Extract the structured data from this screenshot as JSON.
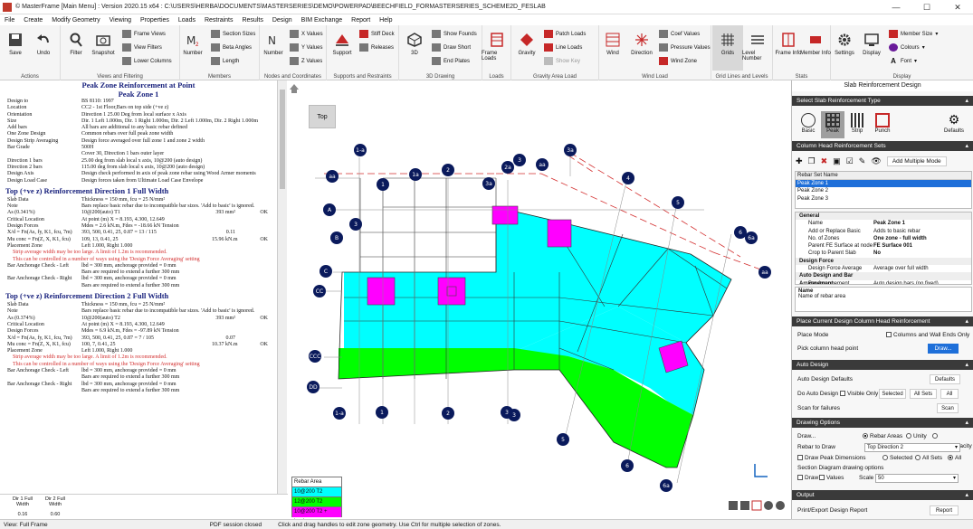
{
  "window": {
    "title": "© MasterFrame [Main Menu] : Version 2020.15 x64 : C:\\USERS\\HERBA\\DOCUMENTS\\MASTERSERIES\\DEMO\\POWERPAD\\BEECHFIELD_FORMASTERSERIES_SCHEME2D_FESLAB",
    "min": "—",
    "max": "☐",
    "close": "✕"
  },
  "menu": [
    "File",
    "Create",
    "Modify Geometry",
    "Viewing",
    "Properties",
    "Loads",
    "Restraints",
    "Results",
    "Design",
    "BIM Exchange",
    "Report",
    "Help"
  ],
  "ribbon": {
    "save": "Save",
    "undo": "Undo",
    "filter": "Filter",
    "snapshot": "Snapshot",
    "frame_views": "Frame Views",
    "view_filters": "View Filters",
    "lower_columns": "Lower Columns",
    "number": "Number",
    "section_sizes": "Section Sizes",
    "beta_angles": "Beta Angles",
    "length": "Length",
    "number2": "Number",
    "x_values": "X Values",
    "y_values": "Y Values",
    "z_values": "Z Values",
    "support": "Support",
    "stiff_deck": "Stiff Deck",
    "releases": "Releases",
    "three_d": "3D",
    "show_founds": "Show Founds",
    "draw_short": "Draw Short",
    "end_plates": "End Plates",
    "frame_loads": "Frame Loads",
    "gravity": "Gravity",
    "patch_loads": "Patch Loads",
    "line_loads": "Line Loads",
    "show_key": "Show Key",
    "wind": "Wind",
    "direction": "Direction",
    "coef_values": "Coef Values",
    "pressure_values": "Pressure Values",
    "wind_zone": "Wind Zone",
    "grids": "Grids",
    "level_number": "Level Number",
    "frame_info": "Frame Info",
    "member_info": "Member Info",
    "settings": "Settings",
    "display": "Display",
    "member_size": "Member Size",
    "colours": "Colours",
    "font": "Font",
    "groups": [
      "Actions",
      "Views and Filtering",
      "Members",
      "Nodes and Coordinates",
      "Supports and Restraints",
      "3D Drawing",
      "Loads",
      "Gravity Area Load",
      "Wind Load",
      "Grid Lines and Levels",
      "Stats",
      "Display"
    ]
  },
  "report": {
    "title1": "Peak Zone Reinforcement at Point",
    "title2": "Peak Zone 1",
    "header_rows": [
      [
        "Design to",
        "BS 8110: 1997"
      ],
      [
        "Location",
        "CC2 - 1st Floor,Bars on top side (+ve z)"
      ],
      [
        "Orientation",
        "Direction 1 25.00 Deg from local surface x Axis"
      ],
      [
        "Size",
        "Dir. 1 Left 1.000m, Dir. 1 Right 1.000m, Dir. 2 Left 1.000m, Dir. 2 Right 1.000m"
      ],
      [
        "Add bars",
        "All bars are additional to any basic rebar defined"
      ],
      [
        "One Zone Design",
        "Common rebars over full peak zone width"
      ],
      [
        "Design Strip Averaging",
        "Design force averaged over full zone 1 and zone 2 width"
      ],
      [
        "Bar Grade",
        "500H"
      ],
      [
        "",
        "Cover 30, Direction 1 bars outer layer"
      ],
      [
        "Direction 1 bars",
        "25.00 deg from slab local x axis, 10@200 (auto design)"
      ],
      [
        "Direction 2 bars",
        "115.00 deg from slab local x axis, 10@200 (auto design)"
      ],
      [
        "Design Axis",
        "Design check performed in axis of peak zone rebar using Wood Armer moments"
      ],
      [
        "Design Load Case",
        "Design forces taken from Ultimate Load Case Envelope"
      ]
    ],
    "dir1_title": "Top (+ve z) Reinforcement Direction 1 Full Width",
    "dir1_rows": [
      [
        "Slab Data",
        "Thickness = 150 mm, fcu = 25 N/mm²",
        "",
        ""
      ],
      [
        "Note",
        "Bars replace basic rebar due to incompatible bar sizes. 'Add to basic' is ignored.",
        "",
        ""
      ],
      [
        "As (0.341%)",
        "10@200(auto) T1",
        "393 mm²",
        "OK"
      ],
      [
        "Critical Location",
        "At point (m) X = 8.193, 4.300, 12.649",
        "",
        ""
      ],
      [
        "Design Forces",
        "Mdes = 2.6 kN.m, Fdes = -18.66 kN Tension",
        "",
        ""
      ],
      [
        "X/d = Fn(As, fy, K1, fcu, 7m)",
        "393, 500, 0.41, 25, 0.87 = 13 / 115",
        "0.11",
        ""
      ],
      [
        "Mu conc = Fn(Z, X, K1, fcu)",
        "109, 13, 0.41, 25",
        "15.96 kN.m",
        "OK"
      ],
      [
        "Placement Zone",
        "Left 1.000, Right 1.000",
        "",
        ""
      ]
    ],
    "dir1_red1": "Strip average width may be too large. A limit of 1.2m is recommended.",
    "dir1_red2": "This can be controlled in a number of ways using the 'Design Force Averaging' setting",
    "dir1_anch": [
      [
        "Bar Anchorage Check - Left",
        "lbd = 300 mm, anchorage provided = 0 mm"
      ],
      [
        "",
        "Bars are required to extend a further 300 mm"
      ],
      [
        "Bar Anchorage Check - Right",
        "lbd = 300 mm, anchorage provided = 0 mm"
      ],
      [
        "",
        "Bars are required to extend a further 300 mm"
      ]
    ],
    "dir2_title": "Top (+ve z) Reinforcement Direction 2 Full Width",
    "dir2_rows": [
      [
        "Slab Data",
        "Thickness = 150 mm, fcu = 25 N/mm²",
        "",
        ""
      ],
      [
        "Note",
        "Bars replace basic rebar due to incompatible bar sizes. 'Add to basic' is ignored.",
        "",
        ""
      ],
      [
        "As (0.374%)",
        "10@200(auto) T2",
        "393 mm²",
        "OK"
      ],
      [
        "Critical Location",
        "At point (m) X = 8.193, 4.300, 12.649",
        "",
        ""
      ],
      [
        "Design Forces",
        "Mdes = 6.9 kN.m, Fdes = -97.89 kN Tension",
        "",
        ""
      ],
      [
        "X/d = Fn(As, fy, K1, fcu, 7m)",
        "393, 500, 0.41, 25, 0.87 = 7 / 105",
        "0.07",
        ""
      ],
      [
        "Mu conc = Fn(Z, X, K1, fcu)",
        "100, 7, 0.41, 25",
        "10.37 kN.m",
        "OK"
      ],
      [
        "Placement Zone",
        "Left 1.000, Right 1.000",
        "",
        ""
      ]
    ],
    "dir2_red1": "Strip average width may be too large. A limit of 1.2m is recommended.",
    "dir2_red2": "This can be controlled in a number of ways using the 'Design Force Averaging' setting",
    "dir2_anch": [
      [
        "Bar Anchorage Check - Left",
        "lbd = 300 mm, anchorage provided = 0 mm"
      ],
      [
        "",
        "Bars are required to extend a further 300 mm"
      ],
      [
        "Bar Anchorage Check - Right",
        "lbd = 300 mm, anchorage provided = 0 mm"
      ],
      [
        "",
        "Bars are required to extend a further 300 mm"
      ]
    ]
  },
  "bottom_table": {
    "h1": "Dir 1 Full Width",
    "h2": "Dir 2 Full Width",
    "v1": "0.16",
    "v2": "0.60"
  },
  "viewport": {
    "top_button": "Top",
    "grid_labels": [
      "1-a",
      "aa",
      "1",
      "1a",
      "2",
      "2a",
      "3",
      "3a",
      "aa",
      "4",
      "5",
      "6",
      "6a",
      "A",
      "B",
      "C",
      "CC",
      "CCC",
      "DD",
      "1-a",
      "1",
      "2",
      "3",
      "3",
      "5",
      "6",
      "6a",
      "aa",
      "3a",
      "3a",
      "4",
      "5",
      "6"
    ],
    "legend": [
      {
        "label": "Rebar Area",
        "color": "#ffffff"
      },
      {
        "label": "10@200 T2",
        "color": "#00ffff"
      },
      {
        "label": "12@200 T2",
        "color": "#00ff00"
      },
      {
        "label": "10@200 T2 + basic",
        "color": "#ff00ff"
      }
    ]
  },
  "panel": {
    "title": "Slab Reinforcement Design",
    "select_type": "Select Slab Reinforcement Type",
    "tabs": [
      "Basic",
      "Peak",
      "Strip",
      "Punch",
      "Defaults"
    ],
    "col_head": "Column Head Reinforcement Sets",
    "add_multiple": "Add Multiple Mode",
    "set_header": "Rebar Set Name",
    "sets": [
      "Peak Zone 1",
      "Peak Zone 2",
      "Peak Zone 3"
    ],
    "props": [
      {
        "cat": true,
        "k": "General",
        "v": ""
      },
      {
        "k": "Name",
        "v": "Peak Zone 1"
      },
      {
        "k": "Add or Replace Basic",
        "v": "Adds to basic rebar"
      },
      {
        "k": "No. of Zones",
        "v": "One zone - full width"
      },
      {
        "k": "Parent FE Surface at node",
        "v": "FE Surface 001"
      },
      {
        "k": "Crop to Parent Slab",
        "v": "No"
      },
      {
        "cat": true,
        "k": "Design Force",
        "v": ""
      },
      {
        "k": "Design Force Average",
        "v": "Average over full width"
      },
      {
        "cat": true,
        "k": "Auto Design and Bar Arrangement",
        "v": ""
      },
      {
        "k": "Bar Arrangement",
        "v": "Auto design bars (no fixed)"
      }
    ],
    "name_title": "Name",
    "name_desc": "Name of rebar area",
    "place_title": "Place Current Design Column Head Reinforcement",
    "place_mode": "Place Mode",
    "cols_walls": "Columns and Wall Ends Only",
    "pick": "Pick column head point",
    "draw": "Draw...",
    "auto_design": "Auto Design",
    "auto_defaults": "Auto Design Defaults",
    "defaults_btn": "Defaults",
    "do_auto": "Do Auto Design",
    "visible_only": "Visible Only",
    "selected": "Selected",
    "all_sets": "All Sets",
    "all": "All",
    "scan_fail": "Scan for failures",
    "scan": "Scan",
    "drawing_options": "Drawing Options",
    "draw_label": "Draw...",
    "rebar_areas": "Rebar Areas",
    "unity": "Unity",
    "force_cap": "Force/Capacity",
    "rebar_to_draw": "Rebar to Draw",
    "top_dir2": "Top Direction 2",
    "draw_peak_dims": "Draw Peak Dimensions",
    "sel2": "Selected",
    "allsets2": "All Sets",
    "all2": "All",
    "section_diag": "Section Diagram drawing options",
    "draw_cb": "Draw",
    "values_cb": "Values",
    "scale": "Scale",
    "scale_val": "50",
    "output": "Output",
    "print_export": "Print/Export Design Report",
    "report_btn": "Report"
  },
  "status": {
    "view": "View: Full Frame",
    "pdf": "PDF session closed",
    "hint": "Click and drag handles to edit zone geometry. Use Ctrl for multiple selection of zones."
  }
}
